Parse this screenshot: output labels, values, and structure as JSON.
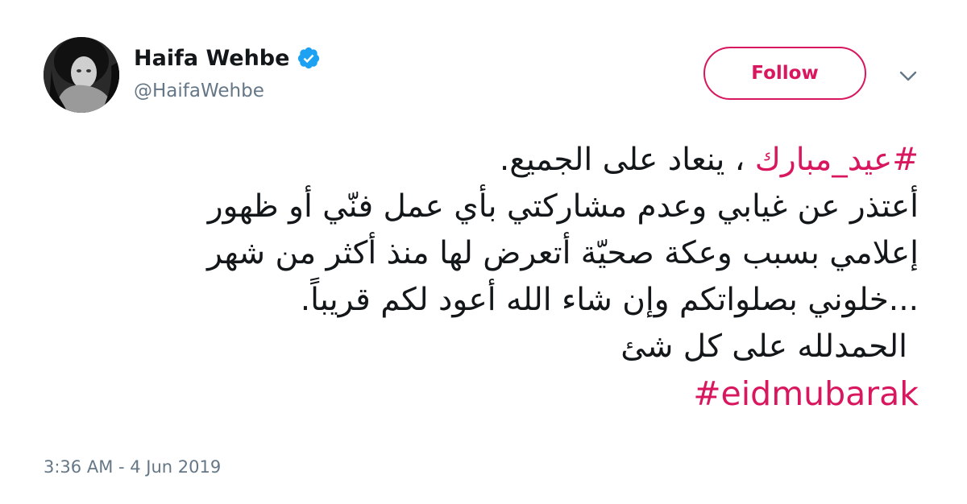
{
  "author": {
    "display_name": "Haifa Wehbe",
    "handle": "@HaifaWehbe",
    "verified_icon": "verified-badge-icon",
    "avatar_icon": "profile-photo"
  },
  "actions": {
    "follow_label": "Follow",
    "menu_icon": "chevron-down-icon"
  },
  "tweet": {
    "line1_hashtag": "#عيد_مبارك",
    "line1_text": " ، ينعاد على الجميع.",
    "line2": "أعتذر عن غيابي وعدم مشاركتي بأي عمل فنّي أو ظهور",
    "line3": "إعلامي بسبب وعكة صحيّة أتعرض لها منذ أكثر من شهر",
    "line4": "...خلوني بصلواتكم وإن شاء الله أعود لكم قريباً.",
    "line5": "الحمدلله على كل شئ",
    "hashtag_en": "#eidmubarak"
  },
  "meta": {
    "timestamp": "3:36 AM - 4 Jun 2019"
  },
  "colors": {
    "accent": "#d8175f",
    "verified": "#1da1f2",
    "secondary_text": "#657786",
    "primary_text": "#14171a"
  }
}
